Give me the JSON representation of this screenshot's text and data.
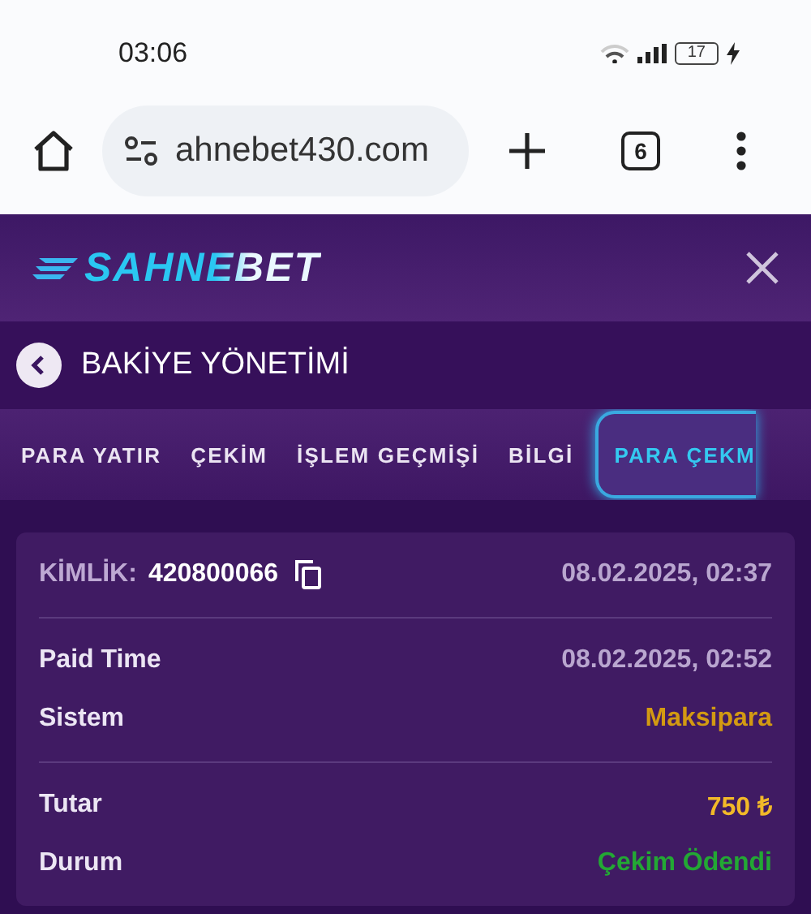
{
  "status_bar": {
    "time": "03:06",
    "battery": "17"
  },
  "browser": {
    "url": "ahnebet430.com",
    "tab_count": "6"
  },
  "header": {
    "logo": "SAHNEBET"
  },
  "title_bar": {
    "title": "BAKİYE YÖNETİMİ"
  },
  "tabs": [
    {
      "label": "PARA YATIR",
      "selected": false
    },
    {
      "label": "ÇEKİM",
      "selected": false
    },
    {
      "label": "İŞLEM GEÇMİŞİ",
      "selected": false
    },
    {
      "label": "BİLGİ",
      "selected": false
    },
    {
      "label": "PARA ÇEKM",
      "selected": true
    }
  ],
  "card": {
    "id_label": "KİMLİK:",
    "id": "420800066",
    "date": "08.02.2025, 02:37",
    "groups": [
      [
        {
          "label": "Paid Time",
          "value": "08.02.2025, 02:52",
          "color": "#b9a6cf"
        },
        {
          "label": "Sistem",
          "value": "Maksipara",
          "color": "#d39a12"
        }
      ],
      [
        {
          "label": "Tutar",
          "value": "750 ₺",
          "color": "#f2b928"
        },
        {
          "label": "Durum",
          "value": "Çekim Ödendi",
          "color": "#23a834"
        }
      ]
    ]
  }
}
